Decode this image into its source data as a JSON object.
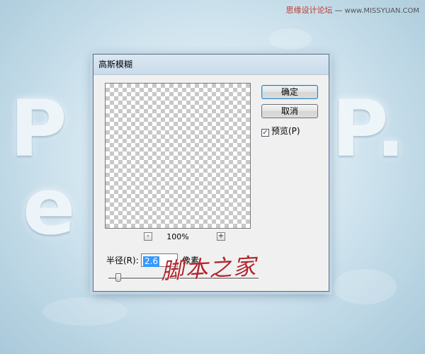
{
  "background": {
    "watermark": {
      "site_name": "思缘设计论坛",
      "separator": "—",
      "url": "www.MISSYUAN.COM"
    }
  },
  "dialog": {
    "title": "高斯模糊",
    "buttons": {
      "ok_label": "确定",
      "cancel_label": "取消"
    },
    "preview_checkbox": {
      "label": "预览(P)",
      "checked": true
    },
    "zoom": {
      "minus": "-",
      "level": "100%",
      "plus": "+"
    },
    "radius": {
      "label": "半径(R):",
      "value": "2.6",
      "unit": "像素"
    },
    "slider": {
      "position_fraction": 0.05
    }
  },
  "overlay_logo": "脚本之家",
  "colors": {
    "accent": "#3399ff",
    "logo": "#b3262e",
    "watermark": "#c0392b"
  }
}
